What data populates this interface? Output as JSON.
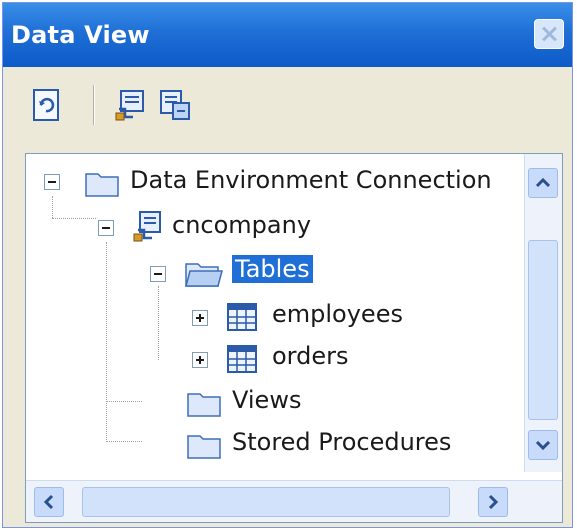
{
  "window": {
    "title": "Data View"
  },
  "toolbar": {
    "buttons": [
      "refresh-icon",
      "connection-icon",
      "data-view-icon"
    ]
  },
  "tree": {
    "root": "Data Environment Connection",
    "connection": "cncompany",
    "tables": "Tables",
    "table_items": [
      "employees",
      "orders"
    ],
    "views": "Views",
    "stored_procedures": "Stored Procedures"
  },
  "colors": {
    "titlebar": "#1f6fd6",
    "selection": "#1f6fd6",
    "scrollbar": "#c8dbfb"
  }
}
